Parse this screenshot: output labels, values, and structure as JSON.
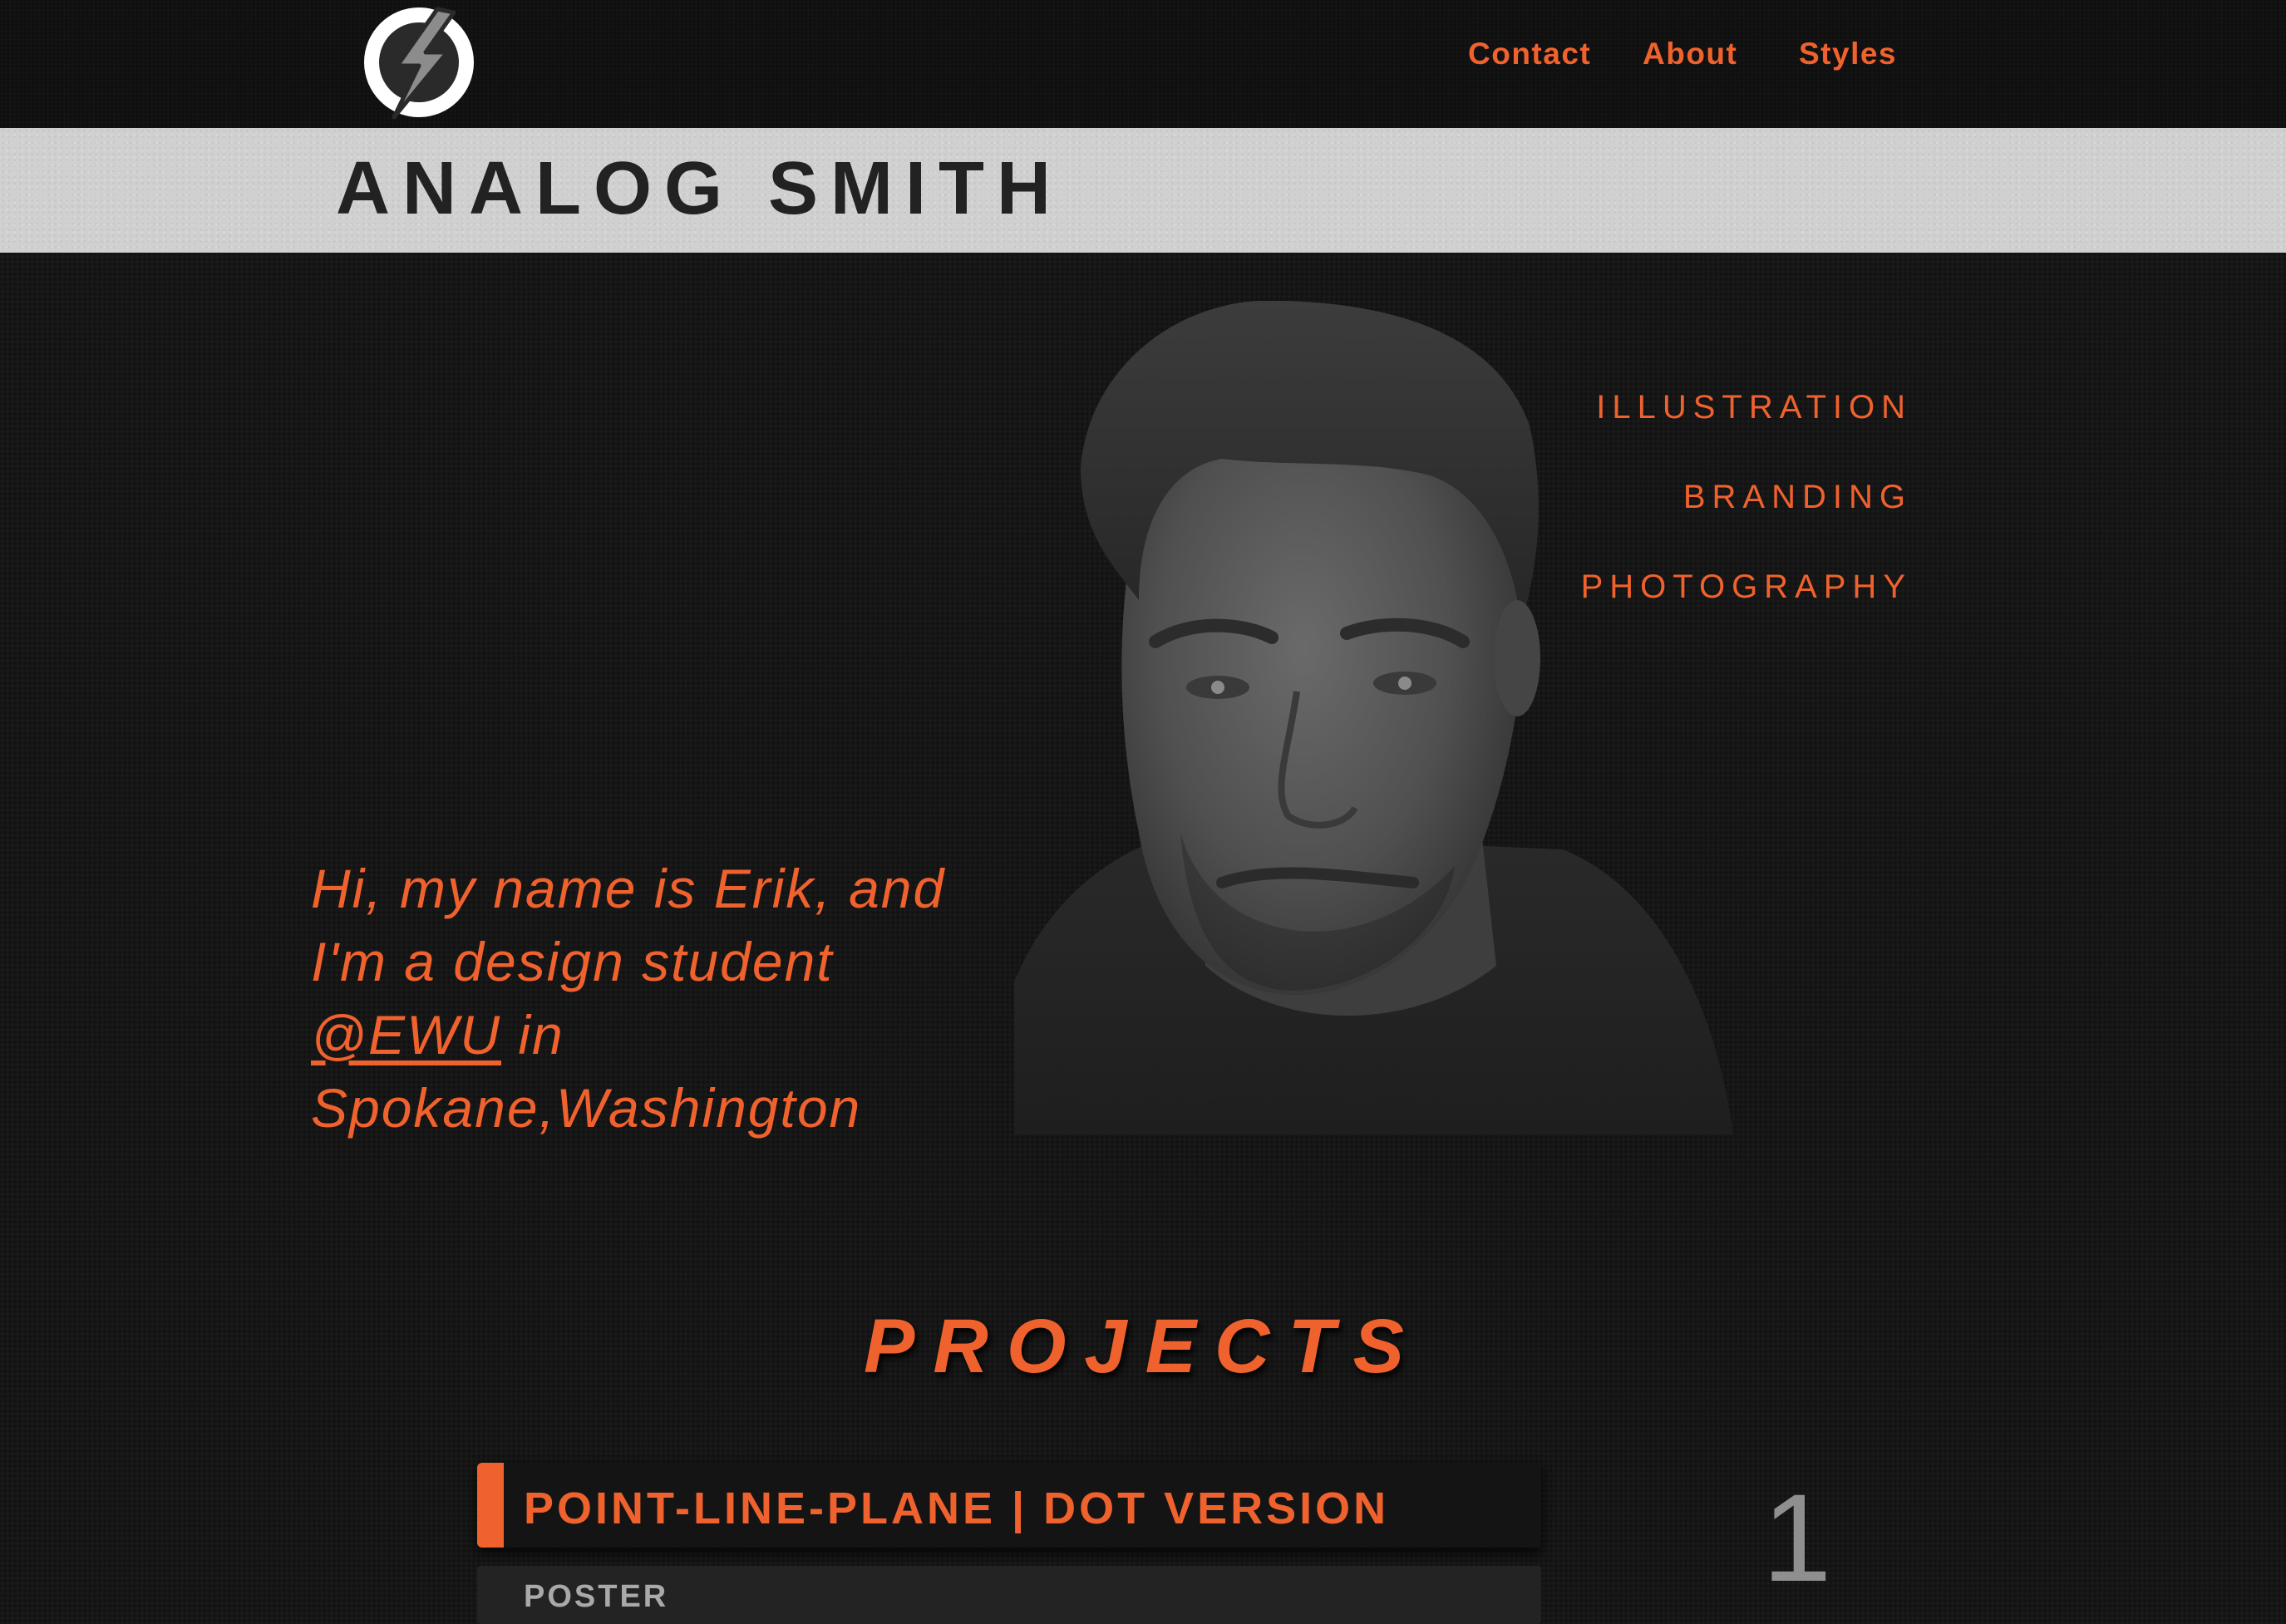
{
  "header": {
    "logo_icon": "lightning-bolt-icon",
    "nav": [
      {
        "label": "Contact"
      },
      {
        "label": "About"
      },
      {
        "label": "Styles"
      }
    ]
  },
  "site": {
    "title": "ANALOG SMITH"
  },
  "hero": {
    "categories": [
      {
        "label": "ILLUSTRATION"
      },
      {
        "label": "BRANDING"
      },
      {
        "label": "PHOTOGRAPHY"
      }
    ],
    "intro": {
      "line1": "Hi, my name is Erik, and",
      "line2": "I'm a design student",
      "link": "@EWU",
      "line3_suffix": " in",
      "line4": "Spokane,Washington"
    }
  },
  "projects": {
    "heading": "PROJECTS",
    "items": [
      {
        "title": "POINT-LINE-PLANE | DOT VERSION",
        "subtitle": "POSTER",
        "number": "1"
      }
    ]
  },
  "colors": {
    "accent": "#f0622d",
    "background": "#161616",
    "band": "#d0d0d0",
    "title_text": "#222222"
  }
}
